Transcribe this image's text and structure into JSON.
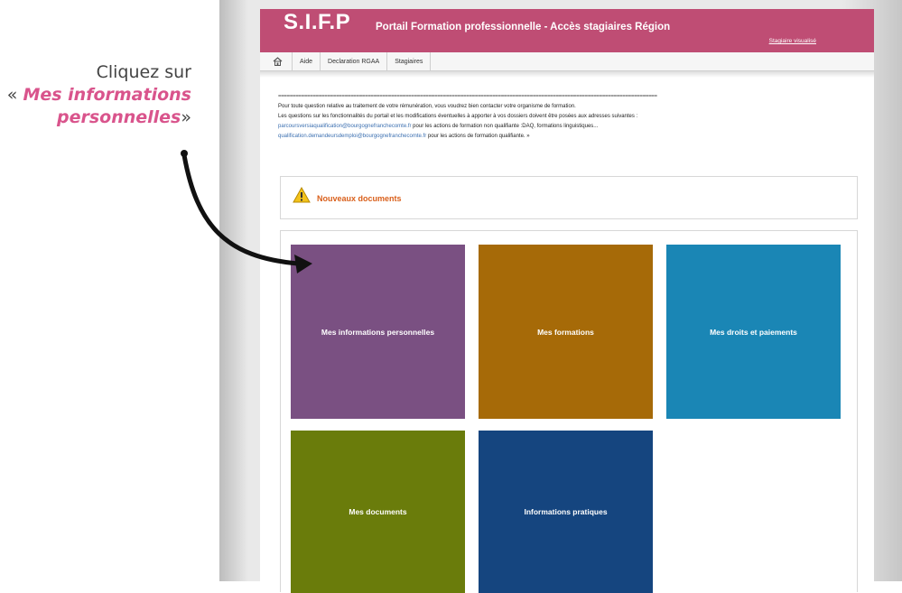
{
  "annotation": {
    "line1": "Cliquez sur",
    "open_quote": "« ",
    "highlight_line1": "Mes informations",
    "highlight_line2": "personnelles",
    "close_quote": "»"
  },
  "header": {
    "logo": "S.I.F.P",
    "title": "Portail Formation professionnelle - Accès stagiaires Région",
    "user_link": "Stagiaire visualisé"
  },
  "nav": {
    "home_icon": "home-icon",
    "items": [
      "Aide",
      "Declaration RGAA",
      "Stagiaires"
    ]
  },
  "messages": {
    "dashes": "=======================================================================================================================================",
    "line1": "Pour toute question relative au traitement de votre rémunération, vous voudrez bien contacter votre organisme de formation.",
    "line2": "Les questions sur les fonctionnalités du portail et les modifications éventuelles à apporter à vos dossiers doivent être posées aux adresses suivantes :",
    "email1": "parcoursversiaqualification@bourgognefranchecomte.fr",
    "line3_suffix": " pour les actions de formation non qualifiante :DAQ, formations linguistiques...",
    "email2": "qualification.demandeursdemploi@bourgognefranchecomte.fr",
    "line4_suffix": " pour les actions de formation qualifiante. »"
  },
  "alert": {
    "icon": "warning-icon",
    "text": "Nouveaux documents"
  },
  "tiles": [
    {
      "label": "Mes informations personnelles",
      "color": "#7a5082"
    },
    {
      "label": "Mes formations",
      "color": "#a66a08"
    },
    {
      "label": "Mes droits et paiements",
      "color": "#1a86b5"
    },
    {
      "label": "Mes documents",
      "color": "#6a7c0b"
    },
    {
      "label": "Informations pratiques",
      "color": "#15457f"
    }
  ],
  "colors": {
    "header_bg": "#bf4d74",
    "highlight": "#d9548c",
    "alert_text": "#d95f1a"
  }
}
